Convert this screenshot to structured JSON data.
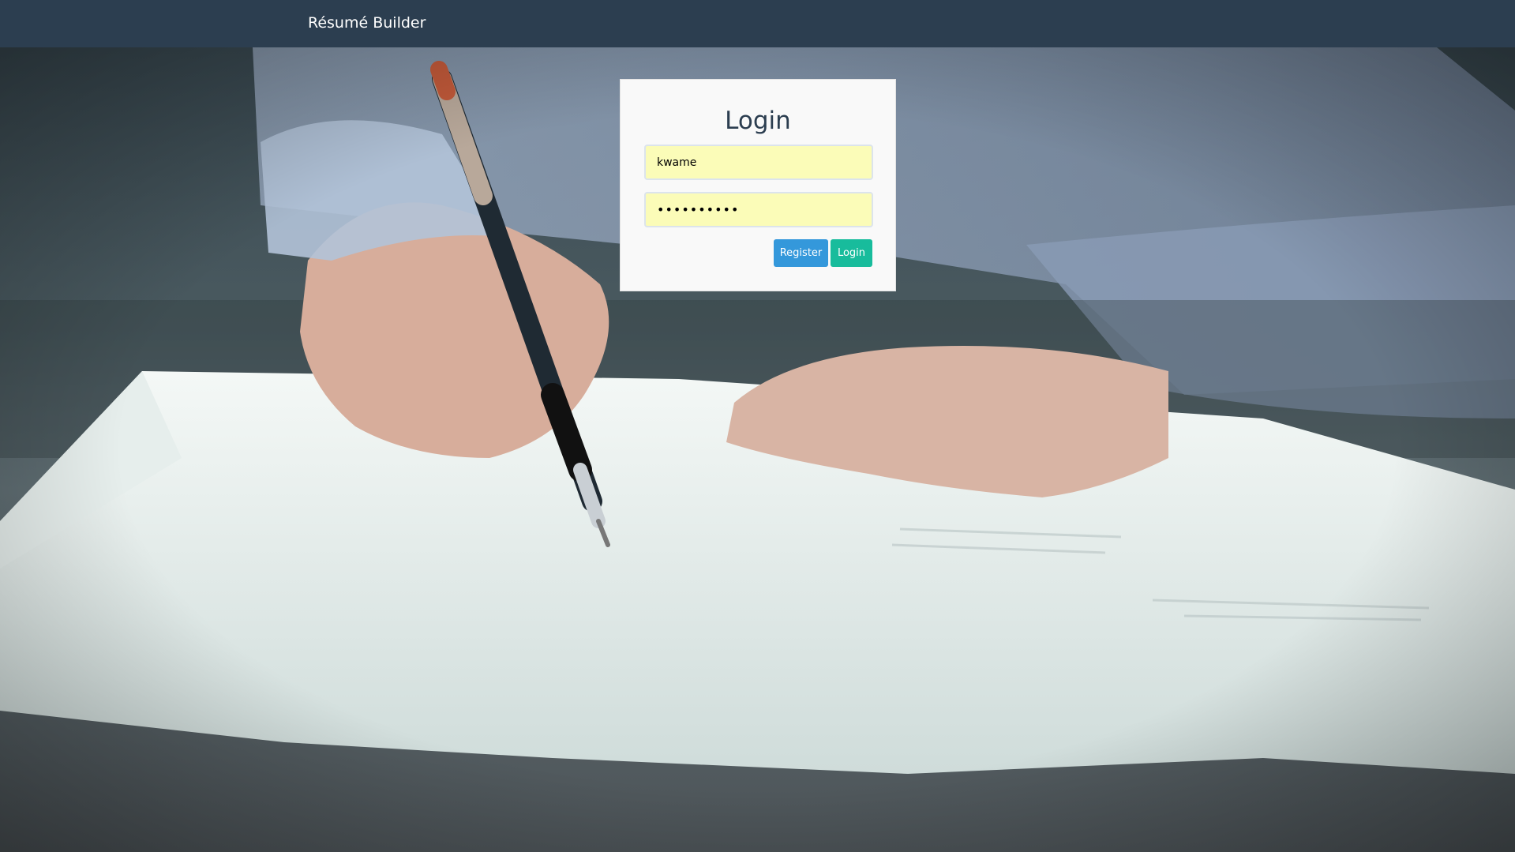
{
  "navbar": {
    "brand": "Résumé Builder"
  },
  "login_form": {
    "title": "Login",
    "username_value": "kwame",
    "password_value": "••••••••••",
    "register_label": "Register",
    "login_label": "Login"
  },
  "colors": {
    "navbar": "#2c3e50",
    "register_button": "#3498db",
    "login_button": "#18bc9c",
    "autofill_field": "#fbfcb8"
  }
}
